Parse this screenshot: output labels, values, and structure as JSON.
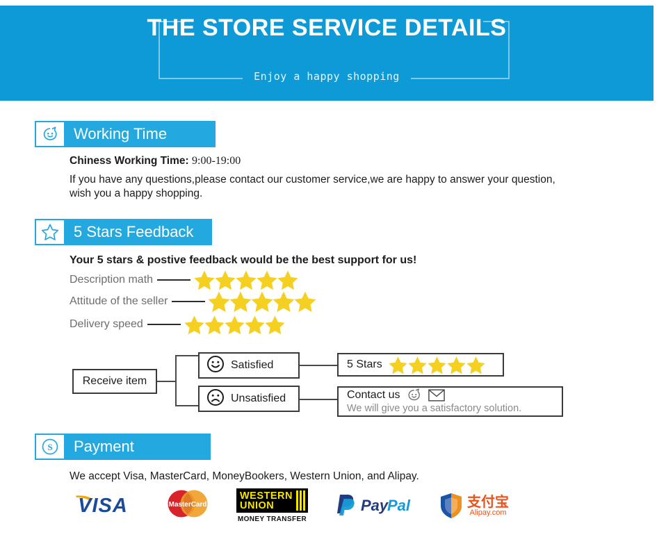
{
  "banner": {
    "title": "THE STORE SERVICE DETAILS",
    "subtitle": "Enjoy a happy shopping",
    "bg_color": "#0d9ad7"
  },
  "sections": {
    "working_time": {
      "heading": "Working Time",
      "icon": "chat-face-icon",
      "label": "Chiness Working Time:",
      "value": "9:00-19:00",
      "note_line1": "If you have any questions,please contact our customer service,we are happy to answer your question,",
      "note_line2": "wish you a happy shopping."
    },
    "feedback": {
      "heading": "5 Stars Feedback",
      "icon": "star-outline-icon",
      "tagline": "Your 5 stars & postive feedback would be the best support for us!",
      "ratings": [
        {
          "label": "Description math",
          "stars": 5
        },
        {
          "label": "Attitude of the seller",
          "stars": 5
        },
        {
          "label": "Delivery speed",
          "stars": 5
        }
      ],
      "flow": {
        "start": "Receive item",
        "satisfied": "Satisfied",
        "unsatisfied": "Unsatisfied",
        "result_stars_label": "5 Stars",
        "result_stars_count": 5,
        "contact_title": "Contact us",
        "contact_sub": "We will give you a satisfactory solution."
      }
    },
    "payment": {
      "heading": "Payment",
      "icon": "dollar-circle-icon",
      "note": "We accept Visa, MasterCard, MoneyBookers, Western Union, and Alipay.",
      "methods": [
        {
          "name": "visa-logo",
          "label": "VISA"
        },
        {
          "name": "mastercard-logo",
          "label": "MasterCard"
        },
        {
          "name": "western-union-logo",
          "label_line1": "WESTERN",
          "label_line2": "UNION",
          "caption": "MONEY TRANSFER"
        },
        {
          "name": "paypal-logo",
          "label": "PayPal"
        },
        {
          "name": "alipay-logo",
          "label": "支付宝",
          "caption": "Alipay.com"
        }
      ]
    }
  },
  "colors": {
    "banner_blue": "#0d9ad7",
    "header_blue": "#23a8e0",
    "star_yellow": "#f5d020"
  }
}
